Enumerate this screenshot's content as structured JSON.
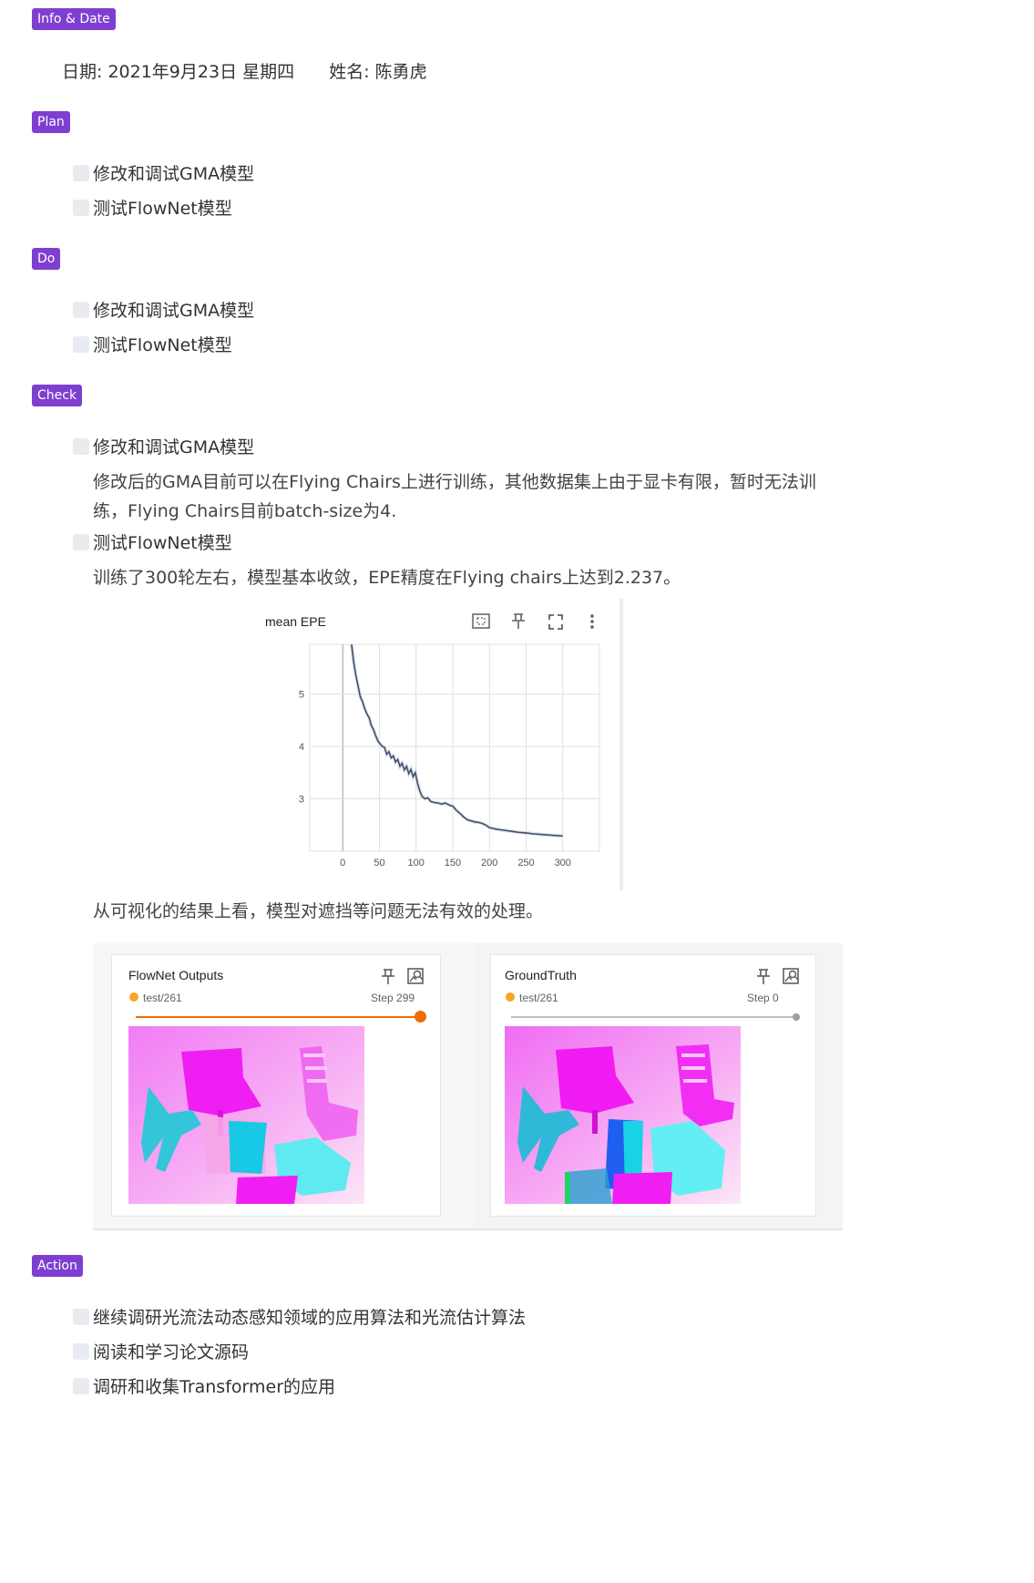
{
  "sections": {
    "info": "Info & Date",
    "plan": "Plan",
    "do": "Do",
    "check": "Check",
    "action": "Action"
  },
  "info_line": {
    "date_label": "日期:",
    "date_value": "2021年9月23日 星期四",
    "name_label": "姓名:",
    "name_value": "陈勇虎"
  },
  "plan": {
    "items": [
      "修改和调试GMA模型",
      "测试FlowNet模型"
    ]
  },
  "do": {
    "items": [
      "修改和调试GMA模型",
      "测试FlowNet模型"
    ]
  },
  "check": {
    "item1": "修改和调试GMA模型",
    "item1_note": "修改后的GMA目前可以在Flying Chairs上进行训练，其他数据集上由于显卡有限，暂时无法训练，Flying Chairs目前batch-size为4.",
    "item2": "测试FlowNet模型",
    "item2_note": "训练了300轮左右，模型基本收敛，EPE精度在Flying chairs上达到2.237。",
    "viz_note": "从可视化的结果上看，模型对遮挡等问题无法有效的处理。"
  },
  "panels": {
    "left": {
      "title": "FlowNet Outputs",
      "run": "test/261",
      "step": "Step 299",
      "dot_color": "#f5a623",
      "slider_color": "#ef6c00"
    },
    "right": {
      "title": "GroundTruth",
      "run": "test/261",
      "step": "Step 0",
      "dot_color": "#f5a623",
      "slider_color": "#9e9e9e"
    }
  },
  "action": {
    "items": [
      "继续调研光流法动态感知领域的应用算法和光流估计算法",
      "阅读和学习论文源码",
      "调研和收集Transformer的应用"
    ]
  },
  "chart_data": {
    "type": "line",
    "title": "mean EPE",
    "x_ticks": [
      0,
      50,
      100,
      150,
      200,
      250,
      300
    ],
    "y_ticks": [
      3,
      4,
      5
    ],
    "xlim": [
      -45,
      350
    ],
    "ylim": [
      2.0,
      5.95
    ],
    "grid": true,
    "line_color": "#425066",
    "series": [
      {
        "x": [
          12,
          15,
          18,
          21,
          24,
          27,
          30,
          33,
          36,
          39,
          42,
          45,
          48,
          51,
          54,
          57,
          60,
          63,
          66,
          69,
          72,
          75,
          78,
          81,
          84,
          87,
          90,
          93,
          96,
          99,
          102,
          105,
          108,
          112,
          116,
          120,
          125,
          130,
          135,
          140,
          145,
          150,
          155,
          160,
          165,
          170,
          175,
          180,
          185,
          190,
          195,
          200,
          210,
          220,
          230,
          240,
          250,
          260,
          270,
          280,
          290,
          300
        ],
        "y": [
          5.95,
          5.6,
          5.35,
          5.15,
          4.95,
          4.85,
          4.72,
          4.62,
          4.55,
          4.4,
          4.32,
          4.2,
          4.1,
          4.05,
          4.0,
          3.98,
          3.85,
          3.9,
          3.78,
          3.82,
          3.7,
          3.75,
          3.62,
          3.68,
          3.55,
          3.62,
          3.48,
          3.56,
          3.42,
          3.5,
          3.3,
          3.15,
          3.05,
          3.0,
          3.02,
          2.95,
          2.93,
          2.92,
          2.9,
          2.92,
          2.88,
          2.86,
          2.78,
          2.72,
          2.65,
          2.6,
          2.58,
          2.56,
          2.55,
          2.53,
          2.5,
          2.45,
          2.42,
          2.4,
          2.38,
          2.36,
          2.35,
          2.33,
          2.32,
          2.31,
          2.3,
          2.29
        ]
      }
    ]
  }
}
